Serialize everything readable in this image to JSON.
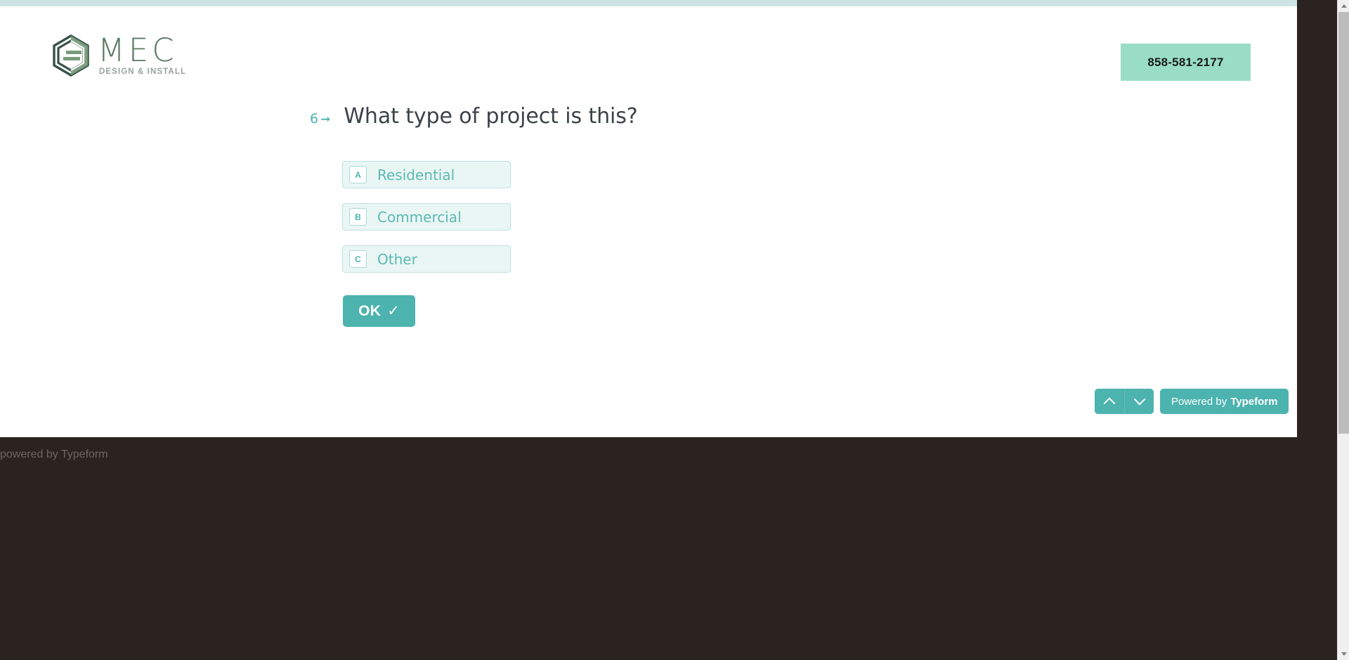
{
  "brand": {
    "logo_title": "MEC",
    "logo_subtitle": "DESIGN & INSTALL",
    "logo_icon": "hexagon-logo-icon",
    "primary_color": "#4cb3af",
    "logo_dark_green": "#37524a",
    "logo_light_green": "#7a9b7e",
    "logo_text_color": "#5d7a63"
  },
  "header": {
    "phone": "858-581-2177",
    "phone_badge_color": "#99ddc6"
  },
  "progress": {
    "bar_color": "#cce5e4",
    "percent": 100
  },
  "question": {
    "number": "6",
    "arrow_icon": "arrow-right-icon",
    "text": "What type of project is this?"
  },
  "choices": [
    {
      "key": "A",
      "label": "Residential"
    },
    {
      "key": "B",
      "label": "Commercial"
    },
    {
      "key": "C",
      "label": "Other"
    }
  ],
  "submit": {
    "label": "OK",
    "check_icon": "✓"
  },
  "nav": {
    "up_icon": "chevron-up-icon",
    "down_icon": "chevron-down-icon",
    "powered_prefix": "Powered by",
    "powered_brand": "Typeform"
  },
  "footer": {
    "text": "powered by Typeform",
    "background": "#2a2320"
  }
}
